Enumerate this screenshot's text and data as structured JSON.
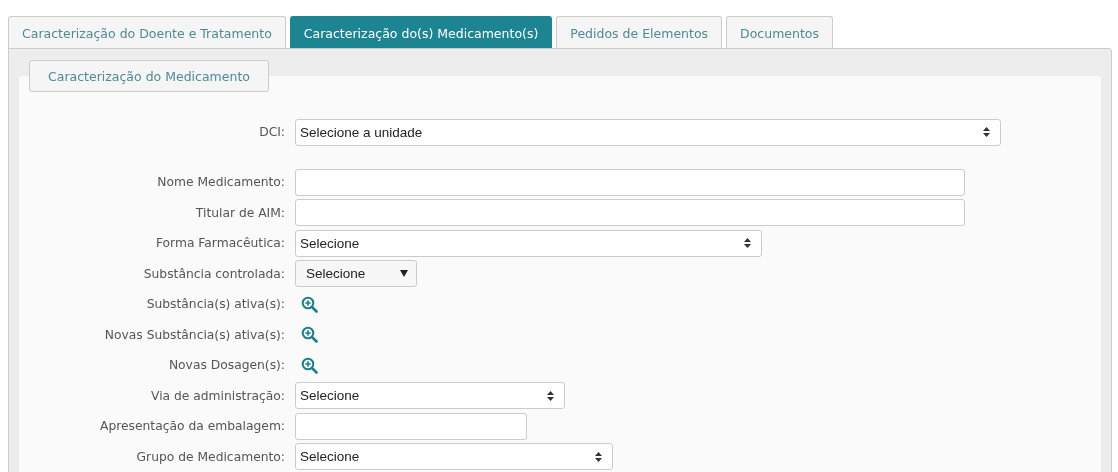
{
  "tabs": [
    {
      "label": "Caracterização do Doente e Tratamento",
      "selected": false
    },
    {
      "label": "Caracterização do(s) Medicamento(s)",
      "selected": true
    },
    {
      "label": "Pedidos de Elementos",
      "selected": false
    },
    {
      "label": "Documentos",
      "selected": false
    }
  ],
  "subtab": {
    "label": "Caracterização do Medicamento"
  },
  "fields": [
    {
      "label": "DCI:",
      "kind": "select",
      "value": "Selecione a unidade"
    },
    {
      "label": "Nome Medicamento:",
      "kind": "text"
    },
    {
      "label": "Titular de AIM:",
      "kind": "text"
    },
    {
      "label": "Forma Farmacêutica:",
      "kind": "select",
      "value": "Selecione"
    },
    {
      "label": "Substância controlada:",
      "kind": "dropdown",
      "value": "Selecione"
    },
    {
      "label": "Substância(s) ativa(s):",
      "kind": "lookup"
    },
    {
      "label": "Novas Substância(s) ativa(s):",
      "kind": "lookup"
    },
    {
      "label": "Novas Dosagen(s):",
      "kind": "lookup"
    },
    {
      "label": "Via de administração:",
      "kind": "select",
      "value": "Selecione"
    },
    {
      "label": "Apresentação da embalagem:",
      "kind": "text"
    },
    {
      "label": "Grupo de Medicamento:",
      "kind": "select",
      "value": "Selecione"
    }
  ]
}
